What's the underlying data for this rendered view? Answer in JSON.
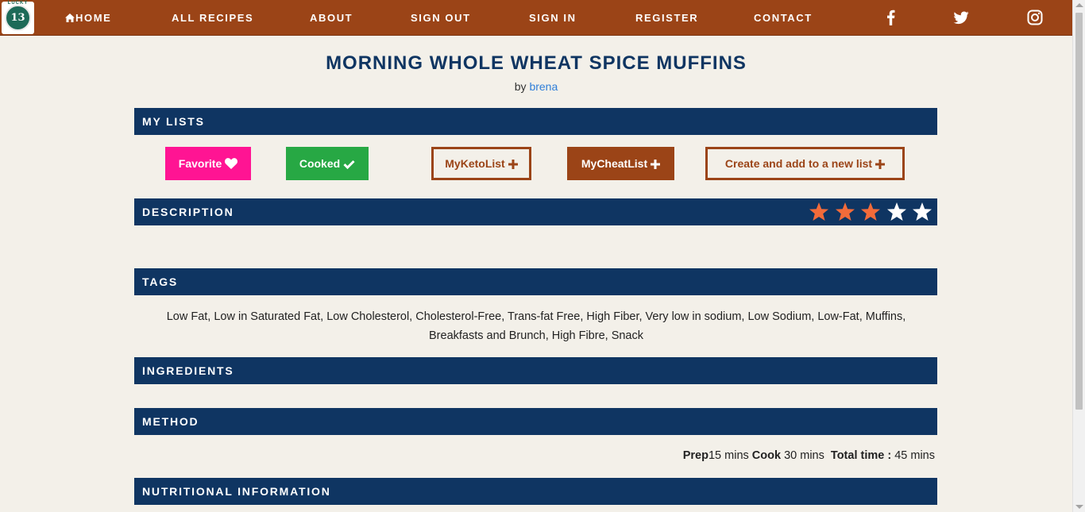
{
  "nav": {
    "logo_top_text": "LUCKY",
    "logo_number": "13",
    "home": "HOME",
    "all_recipes": "ALL RECIPES",
    "about": "ABOUT",
    "sign_out": "SIGN OUT",
    "sign_in": "SIGN IN",
    "register": "REGISTER",
    "contact": "CONTACT",
    "icons": [
      "home-icon",
      "facebook-icon",
      "twitter-icon",
      "instagram-icon"
    ]
  },
  "recipe": {
    "title": "MORNING WHOLE WHEAT SPICE MUFFINS",
    "by_prefix": "by",
    "author": "brena"
  },
  "sections": {
    "my_lists": "MY LISTS",
    "description": "DESCRIPTION",
    "tags": "TAGS",
    "ingredients": "INGREDIENTS",
    "method": "METHOD",
    "nutrition": "NUTRITIONAL INFORMATION"
  },
  "lists": {
    "favorite": "Favorite",
    "cooked": "Cooked",
    "keto": "MyKetoList",
    "cheat": "MyCheatList",
    "new_list": "Create and add to a new list"
  },
  "rating": {
    "value": 3,
    "max": 5
  },
  "tags_text": "Low Fat, Low in Saturated Fat, Low Cholesterol, Cholesterol-Free, Trans-fat Free, High Fiber, Very low in sodium, Low Sodium, Low-Fat, Muffins, Breakfasts and Brunch, High Fibre, Snack",
  "times": {
    "prep_label": "Prep",
    "prep_value": "15 mins",
    "cook_label": "Cook",
    "cook_value": "30 mins",
    "total_label": "Total time :",
    "total_value": "45 mins"
  },
  "colors": {
    "nav": "#9b4417",
    "section_bar": "#0f3562",
    "favorite": "#ff1493",
    "cooked": "#27a844",
    "star_filled": "#f26b3a",
    "star_empty": "#ffffff",
    "link": "#2f7ed8"
  }
}
